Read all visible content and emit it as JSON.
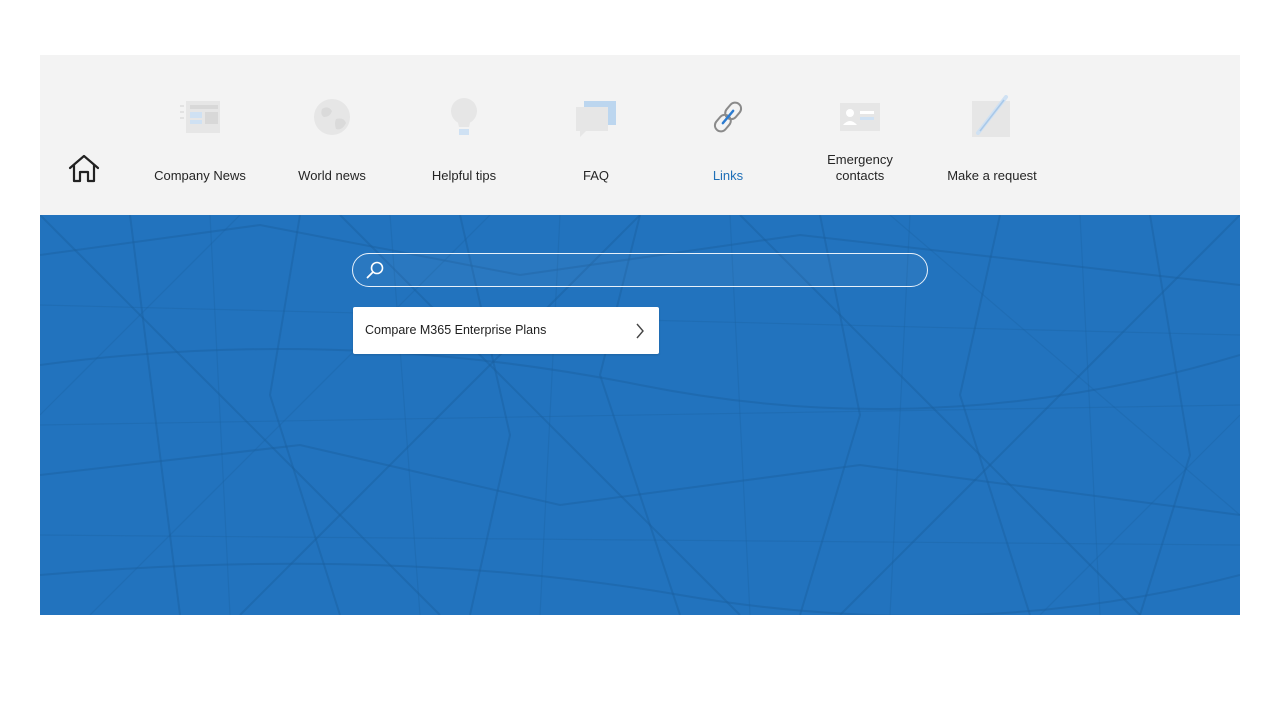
{
  "nav": {
    "home": {
      "icon": "home-icon"
    },
    "items": [
      {
        "label": "Company News",
        "icon": "newspaper-icon",
        "active": false
      },
      {
        "label": "World news",
        "icon": "globe-icon",
        "active": false
      },
      {
        "label": "Helpful tips",
        "icon": "lightbulb-icon",
        "active": false
      },
      {
        "label": "FAQ",
        "icon": "chat-bubble-icon",
        "active": false
      },
      {
        "label": "Links",
        "icon": "link-icon",
        "active": true
      },
      {
        "label": "Emergency\ncontacts",
        "icon": "contact-card-icon",
        "active": false
      },
      {
        "label": "Make a request",
        "icon": "pencil-icon",
        "active": false
      }
    ]
  },
  "search": {
    "placeholder": "",
    "value": ""
  },
  "results": [
    {
      "label": "Compare M365 Enterprise Plans"
    }
  ],
  "colors": {
    "nav_background": "#f3f3f3",
    "hero_background": "#2273be",
    "active_link": "#1f6fb7",
    "icon_light_blue": "#cfe1f3"
  }
}
